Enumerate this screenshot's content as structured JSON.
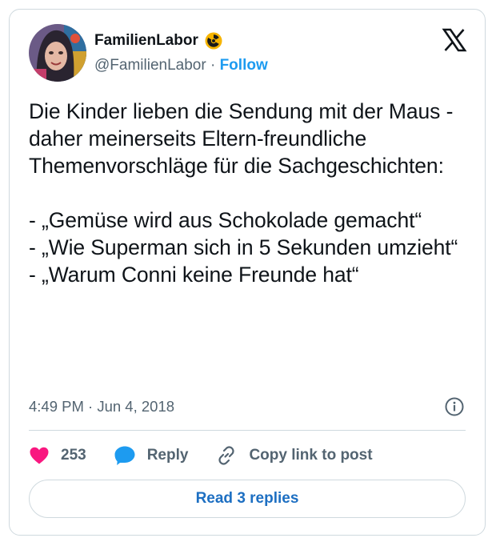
{
  "author": {
    "name": "FamilienLabor",
    "handle": "@FamilienLabor",
    "separator": "·",
    "follow_label": "Follow",
    "badge_icon": "radioactive-icon"
  },
  "tweet": {
    "text": "Die Kinder lieben die Sendung mit der Maus - daher meinerseits Eltern-freundliche Themenvorschläge für die Sachgeschichten:\n\n- „Gemüse wird aus Schokolade gemacht“\n- „Wie Superman sich in 5 Sekunden umzieht“\n- „Warum Conni keine Freunde hat“",
    "timestamp": "4:49 PM · Jun 4, 2018"
  },
  "actions": {
    "like_count": "253",
    "reply_label": "Reply",
    "copy_label": "Copy link to post"
  },
  "replies_button": "Read 3 replies",
  "colors": {
    "like": "#f91880",
    "reply": "#1d9bf0",
    "link": "#1d9bf0",
    "border": "#cfd9de",
    "muted": "#536471"
  }
}
